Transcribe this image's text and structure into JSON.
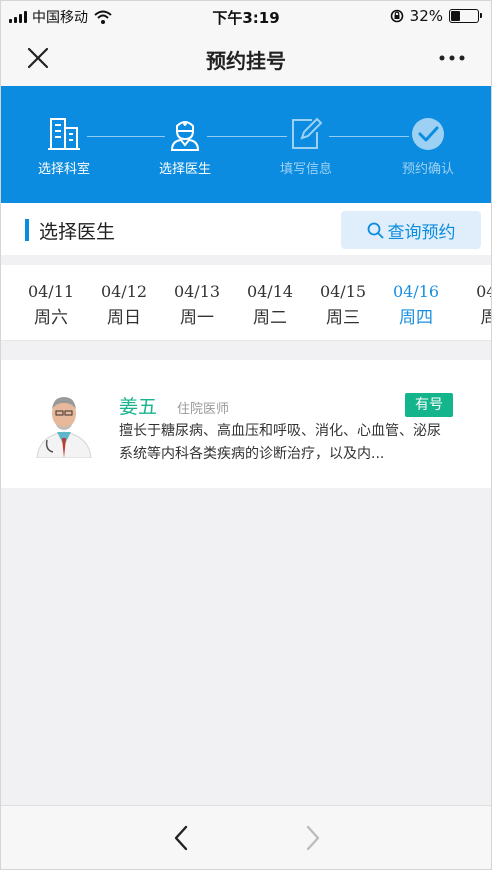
{
  "status_bar": {
    "carrier": "中国移动",
    "time": "下午3:19",
    "battery_text": "32%",
    "battery_level": 0.32
  },
  "nav": {
    "title": "预约挂号",
    "close_icon": "close-icon",
    "more_icon": "more-icon"
  },
  "steps": [
    {
      "label": "选择科室",
      "icon": "building-icon",
      "active": true
    },
    {
      "label": "选择医生",
      "icon": "doctor-icon",
      "active": true
    },
    {
      "label": "填写信息",
      "icon": "edit-icon",
      "active": false
    },
    {
      "label": "预约确认",
      "icon": "check-circle-icon",
      "active": false
    }
  ],
  "section": {
    "title": "选择医生",
    "query_button": "查询预约"
  },
  "dates": [
    {
      "date": "04/11",
      "weekday": "周六"
    },
    {
      "date": "04/12",
      "weekday": "周日"
    },
    {
      "date": "04/13",
      "weekday": "周一"
    },
    {
      "date": "04/14",
      "weekday": "周二"
    },
    {
      "date": "04/15",
      "weekday": "周三"
    },
    {
      "date": "04/16",
      "weekday": "周四",
      "selected": true
    },
    {
      "date": "04/",
      "weekday": "周"
    }
  ],
  "doctor": {
    "name": "姜五",
    "title": "住院医师",
    "availability": "有号",
    "description": "擅长于糖尿病、高血压和呼吸、消化、心血管、泌尿系统等内科各类疾病的诊断治疗，以及内..."
  },
  "colors": {
    "primary": "#0c8ce0",
    "accent_green": "#14b48c",
    "selected_date": "#1a8fe0"
  }
}
